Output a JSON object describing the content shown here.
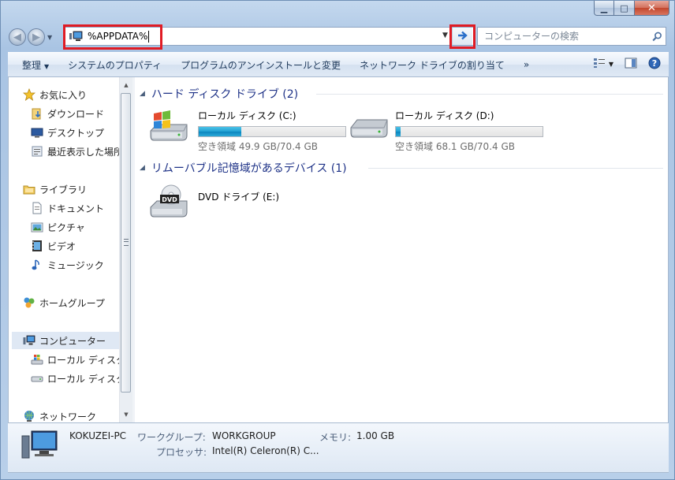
{
  "window": {
    "buttons": {
      "minimize": "▁",
      "maximize": "□",
      "close": "✕"
    }
  },
  "address_bar": {
    "value": "%APPDATA%",
    "go_icon": "arrow-right-icon"
  },
  "search": {
    "placeholder": "コンピューターの検索"
  },
  "toolbar": {
    "items": [
      "整理",
      "システムのプロパティ",
      "プログラムのアンインストールと変更",
      "ネットワーク ドライブの割り当て",
      "»"
    ]
  },
  "nav_pane": {
    "items": [
      {
        "label": "お気に入り",
        "icon": "star-icon"
      },
      {
        "label": "ダウンロード",
        "icon": "download-folder-icon"
      },
      {
        "label": "デスクトップ",
        "icon": "desktop-icon"
      },
      {
        "label": "最近表示した場所",
        "icon": "recent-places-icon"
      },
      {
        "label": "ライブラリ",
        "icon": "library-icon"
      },
      {
        "label": "ドキュメント",
        "icon": "document-icon"
      },
      {
        "label": "ピクチャ",
        "icon": "picture-icon"
      },
      {
        "label": "ビデオ",
        "icon": "video-icon"
      },
      {
        "label": "ミュージック",
        "icon": "music-icon"
      },
      {
        "label": "ホームグループ",
        "icon": "homegroup-icon"
      },
      {
        "label": "コンピューター",
        "icon": "computer-icon"
      },
      {
        "label": "ローカル ディスク (C:)",
        "icon": "windows-drive-icon"
      },
      {
        "label": "ローカル ディスク (D:)",
        "icon": "drive-icon"
      },
      {
        "label": "ネットワーク",
        "icon": "network-icon"
      }
    ]
  },
  "groups": {
    "hdd": {
      "title": "ハード ディスク ドライブ (2)"
    },
    "removable": {
      "title": "リムーバブル記憶域があるデバイス (1)"
    }
  },
  "drives": [
    {
      "name": "ローカル ディスク (C:)",
      "free": "空き領域 49.9 GB/70.4 GB",
      "used_fraction": 0.29,
      "icon": "windows-drive-icon"
    },
    {
      "name": "ローカル ディスク (D:)",
      "free": "空き領域 68.1 GB/70.4 GB",
      "used_fraction": 0.033,
      "icon": "drive-icon"
    },
    {
      "name": "DVD ドライブ (E:)",
      "icon": "dvd-drive-icon"
    }
  ],
  "details": {
    "pc_name": "KOKUZEI-PC",
    "workgroup_label": "ワークグループ:",
    "workgroup_value": "WORKGROUP",
    "memory_label": "メモリ:",
    "memory_value": "1.00 GB",
    "processor_label": "プロセッサ:",
    "processor_value": "Intel(R) Celeron(R) C..."
  }
}
